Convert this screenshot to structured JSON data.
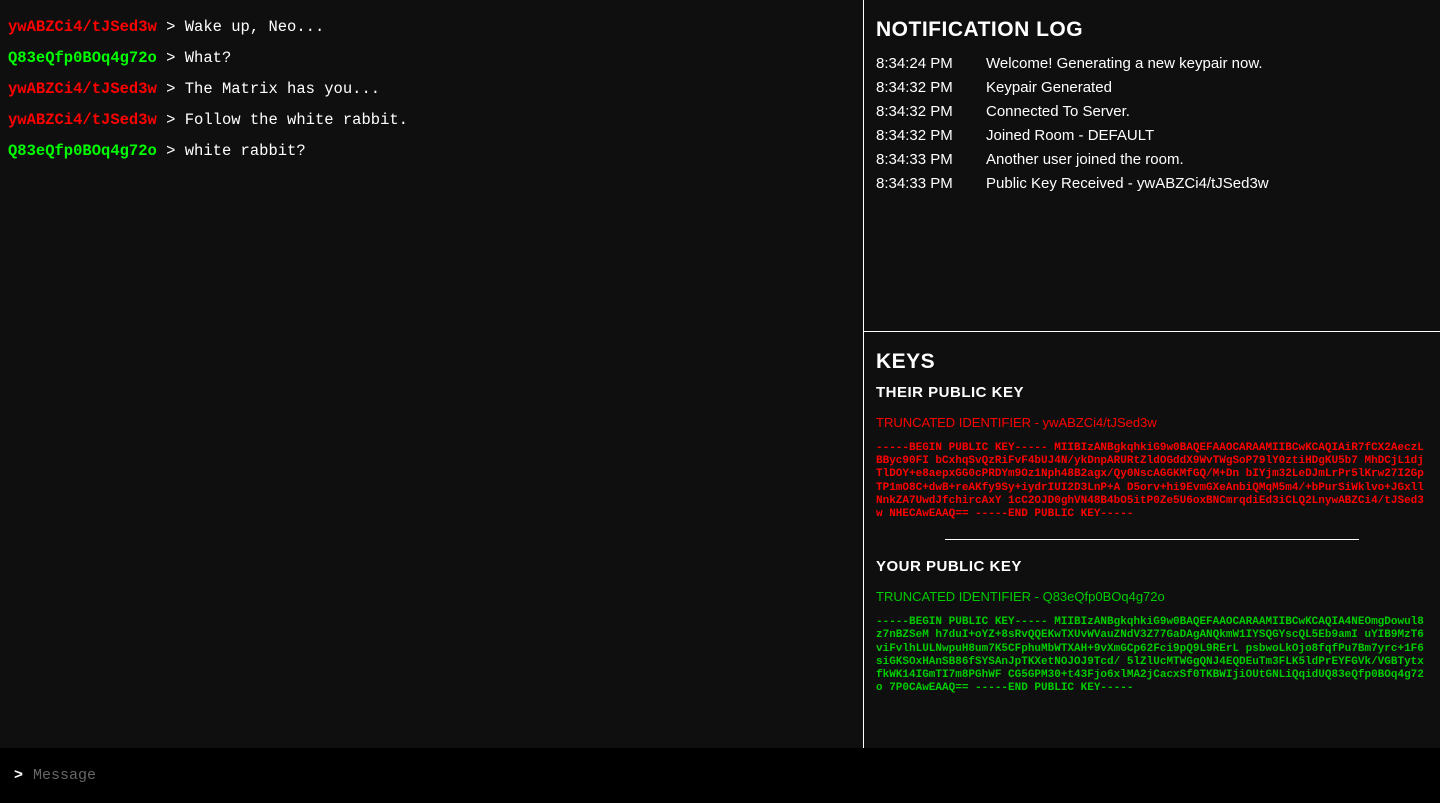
{
  "chat": {
    "messages": [
      {
        "sender": "ywABZCi4/tJSed3w",
        "color": "red",
        "text": "Wake up, Neo..."
      },
      {
        "sender": "Q83eQfp0BOq4g72o",
        "color": "green",
        "text": "What?"
      },
      {
        "sender": "ywABZCi4/tJSed3w",
        "color": "red",
        "text": "The Matrix has you..."
      },
      {
        "sender": "ywABZCi4/tJSed3w",
        "color": "red",
        "text": "Follow the white rabbit."
      },
      {
        "sender": "Q83eQfp0BOq4g72o",
        "color": "green",
        "text": "white rabbit?"
      }
    ]
  },
  "notifications": {
    "title": "NOTIFICATION LOG",
    "entries": [
      {
        "time": "8:34:24 PM",
        "text": "Welcome! Generating a new keypair now."
      },
      {
        "time": "8:34:32 PM",
        "text": "Keypair Generated"
      },
      {
        "time": "8:34:32 PM",
        "text": "Connected To Server."
      },
      {
        "time": "8:34:32 PM",
        "text": "Joined Room - DEFAULT"
      },
      {
        "time": "8:34:33 PM",
        "text": "Another user joined the room."
      },
      {
        "time": "8:34:33 PM",
        "text": "Public Key Received - ywABZCi4/tJSed3w"
      }
    ]
  },
  "keys": {
    "title": "KEYS",
    "their": {
      "label": "THEIR PUBLIC KEY",
      "trunc_label": "TRUNCATED IDENTIFIER - ywABZCi4/tJSed3w",
      "key": "-----BEGIN PUBLIC KEY-----  MIIBIzANBgkqhkiG9w0BAQEFAAOCARAAMIIBCwKCAQIAiR7fCX2AeczLBByc90FI bCxhqSvQzRiFvF4bUJ4N/ykDnpARURtZldOGddX9WvTWgSoP79lY0ztiHDgKU5b7 MhDCjL1djTlDOY+e8aepxGG0cPRDYm9Oz1Nph48B2agx/Qy0NscAGGKMfGQ/M+Dn bIYjm32LeDJmLrPr5lKrw27I2GpTP1mO8C+dwB+reAKfy9Sy+iydrIUI2D3LnP+A D5orv+hi9EvmGXeAnbiQMqM5m4/+bPurSiWklvo+JGxllNnkZA7UwdJfchircAxY 1cC2OJD0ghVN48B4bO5itP0Ze5U6oxBNCmrqdiEd3iCLQ2LnywABZCi4/tJSed3w NHECAwEAAQ== -----END PUBLIC KEY-----"
    },
    "your": {
      "label": "YOUR PUBLIC KEY",
      "trunc_label": "TRUNCATED IDENTIFIER - Q83eQfp0BOq4g72o",
      "key": "-----BEGIN PUBLIC KEY-----  MIIBIzANBgkqhkiG9w0BAQEFAAOCARAAMIIBCwKCAQIA4NEOmgDowul8z7nBZSeM h7duI+oYZ+8sRvQQEKwTXUvWVauZNdV3Z77GaDAgANQkmW1IYSQGYscQL5Eb9amI uYIB9MzT6viFvlhLULNwpuH8um7K5CFphuMbWTXAH+9vXmGCp62Fci9pQ9L9RErL psbwoLkOjo8fqfPu7Bm7yrc+1F6siGKSOxHAnSB86fSYSAnJpTKXetNOJOJ9Tcd/ 5lZlUcMTWGgQNJ4EQDEuTm3FLK5ldPrEYFGVk/VGBTytxfkWK14IGmTI7m8PGhWF CG5GPM30+t43Fjo6xlMA2jCacxSf0TKBWIjiOUtGNLiQqidUQ83eQfp0BOq4g72o 7P0CAwEAAQ== -----END PUBLIC KEY-----"
    }
  },
  "input": {
    "prompt": ">",
    "placeholder": "Message"
  },
  "colors": {
    "red": "#ff0000",
    "green": "#00ff00",
    "bg": "#0f0f0f",
    "input_bg": "#000000"
  }
}
